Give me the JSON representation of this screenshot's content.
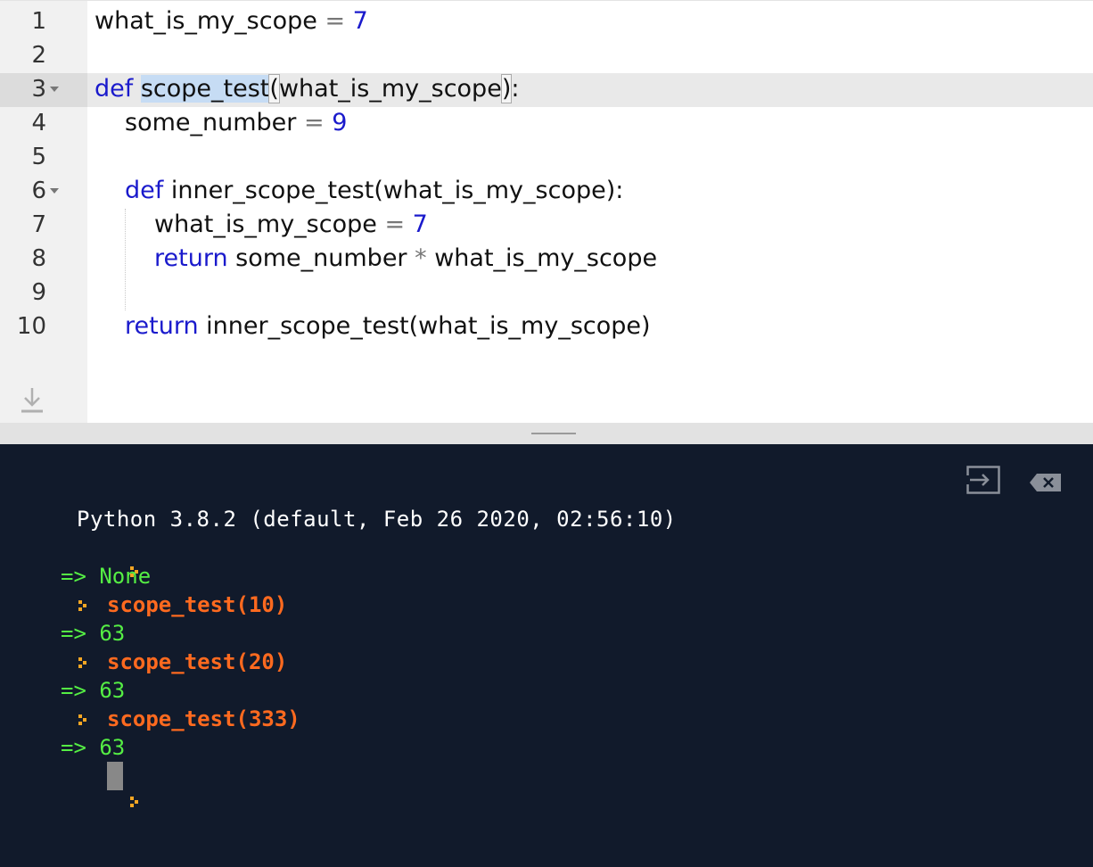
{
  "editor": {
    "lines": [
      {
        "num": "1",
        "fold": false
      },
      {
        "num": "2",
        "fold": false
      },
      {
        "num": "3",
        "fold": true
      },
      {
        "num": "4",
        "fold": false
      },
      {
        "num": "5",
        "fold": false
      },
      {
        "num": "6",
        "fold": true
      },
      {
        "num": "7",
        "fold": false
      },
      {
        "num": "8",
        "fold": false
      },
      {
        "num": "9",
        "fold": false
      },
      {
        "num": "10",
        "fold": false
      }
    ],
    "code": {
      "l1_name": "what_is_my_scope",
      "l1_eq": "=",
      "l1_val": "7",
      "l3_def": "def",
      "l3_fn": "scope_test",
      "l3_open": "(",
      "l3_param": "what_is_my_scope",
      "l3_close": ")",
      "l3_colon": ":",
      "l4_name": "some_number",
      "l4_eq": "=",
      "l4_val": "9",
      "l6_def": "def",
      "l6_rest": "inner_scope_test(what_is_my_scope):",
      "l7_name": "what_is_my_scope",
      "l7_eq": "=",
      "l7_val": "7",
      "l8_return": "return",
      "l8_a": "some_number",
      "l8_op": "*",
      "l8_b": "what_is_my_scope",
      "l10_return": "return",
      "l10_rest": "inner_scope_test(what_is_my_scope)"
    },
    "download_icon": "download-icon"
  },
  "console": {
    "banner": "Python 3.8.2 (default, Feb 26 2020, 02:56:10)",
    "arrow": "=>",
    "out1": "None",
    "in1": "scope_test(10)",
    "out2": "63",
    "in2": "scope_test(20)",
    "out3": "63",
    "in3": "scope_test(333)",
    "out4": "63",
    "run_icon": "run-icon",
    "clear_icon": "clear-icon"
  },
  "colors": {
    "console_bg": "#111a2b",
    "output_green": "#55ee44",
    "input_orange": "#ff6a1f",
    "prompt_yellow": "#f5a623",
    "keyword_blue": "#1a1acc"
  }
}
